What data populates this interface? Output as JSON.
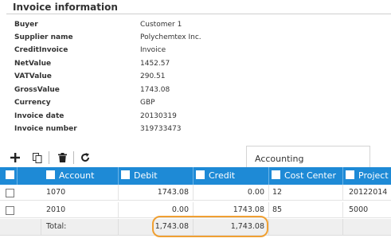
{
  "section": {
    "title": "Invoice information"
  },
  "info": [
    {
      "label": "Buyer",
      "value": "Customer 1"
    },
    {
      "label": "Supplier name",
      "value": "Polychemtex Inc."
    },
    {
      "label": "CreditInvoice",
      "value": "Invoice"
    },
    {
      "label": "NetValue",
      "value": "1452.57"
    },
    {
      "label": "VATValue",
      "value": "290.51"
    },
    {
      "label": "GrossValue",
      "value": "1743.08"
    },
    {
      "label": "Currency",
      "value": "GBP"
    },
    {
      "label": "Invoice date",
      "value": "20130319"
    },
    {
      "label": "Invoice number",
      "value": "319733473"
    }
  ],
  "toolbar": {
    "add_icon": "plus-icon",
    "copy_icon": "copy-icon",
    "delete_icon": "trash-icon",
    "refresh_icon": "refresh-icon"
  },
  "accounting_box": {
    "label": "Accounting"
  },
  "grid": {
    "columns": [
      "Account",
      "Debit",
      "Credit",
      "Cost Center",
      "Project"
    ],
    "rows": [
      {
        "account": "1070",
        "debit": "1743.08",
        "credit": "0.00",
        "cost_center": "12",
        "project": "20122014"
      },
      {
        "account": "2010",
        "debit": "0.00",
        "credit": "1743.08",
        "cost_center": "85",
        "project": "5000"
      }
    ],
    "total": {
      "label": "Total:",
      "debit": "1,743.08",
      "credit": "1,743.08"
    }
  },
  "colors": {
    "header_bg": "#1e8ad6",
    "highlight": "#f0a032",
    "total_bg": "#efefef"
  }
}
